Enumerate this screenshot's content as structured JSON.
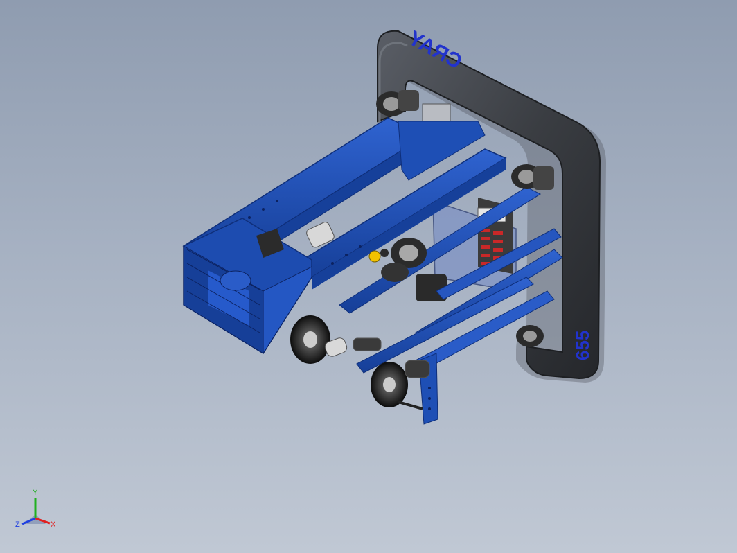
{
  "viewport": {
    "background_top": "#8f9cb0",
    "background_bottom": "#c0c8d4"
  },
  "model": {
    "frame_label": "CRAY",
    "frame_number": "655",
    "colors": {
      "frame_blue": "#1e4fb5",
      "frame_blue_dark": "#0f2f7a",
      "bumper_gray": "#3a3d42",
      "wheel_black": "#1c1c1c",
      "plate_translucent": "#7f93c4",
      "accent_yellow": "#f2c200",
      "text_blue": "#2233cc"
    }
  },
  "triad": {
    "x_label": "X",
    "y_label": "Y",
    "z_label": "Z",
    "x_color": "#e02020",
    "y_color": "#20b020",
    "z_color": "#2040e0"
  }
}
